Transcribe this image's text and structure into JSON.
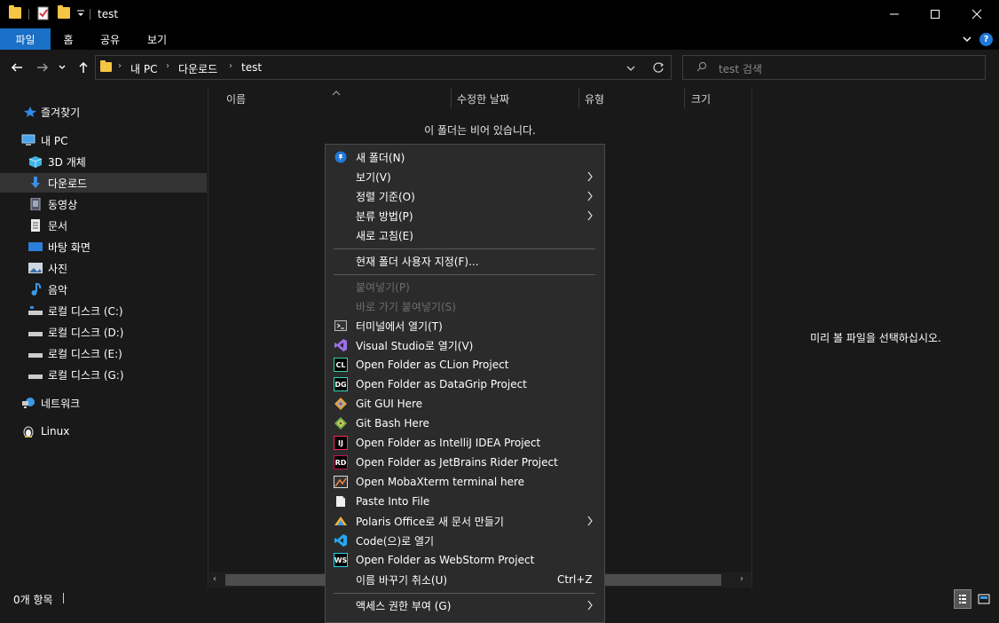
{
  "window": {
    "title": "test",
    "quick_access_icons": [
      "folder-icon",
      "properties-icon",
      "new-folder-icon",
      "customize-dropdown-icon"
    ],
    "controls": [
      "minimize-icon",
      "maximize-icon",
      "close-icon"
    ]
  },
  "ribbon": {
    "tabs": [
      {
        "label": "파일",
        "active": true
      },
      {
        "label": "홈"
      },
      {
        "label": "공유"
      },
      {
        "label": "보기"
      }
    ]
  },
  "address": {
    "segments": [
      "내 PC",
      "다운로드",
      "test"
    ],
    "search_placeholder": "test 검색"
  },
  "sidebar": {
    "items": [
      {
        "label": "즐겨찾기",
        "icon": "star-icon"
      },
      {
        "label": "내 PC",
        "icon": "pc-icon"
      },
      {
        "label": "3D 개체",
        "icon": "cube-icon"
      },
      {
        "label": "다운로드",
        "icon": "download-icon",
        "selected": true
      },
      {
        "label": "동영상",
        "icon": "video-icon"
      },
      {
        "label": "문서",
        "icon": "document-icon"
      },
      {
        "label": "바탕 화면",
        "icon": "desktop-icon"
      },
      {
        "label": "사진",
        "icon": "picture-icon"
      },
      {
        "label": "음악",
        "icon": "music-icon"
      },
      {
        "label": "로컬 디스크 (C:)",
        "icon": "drive-icon"
      },
      {
        "label": "로컬 디스크 (D:)",
        "icon": "drive-icon"
      },
      {
        "label": "로컬 디스크 (E:)",
        "icon": "drive-icon"
      },
      {
        "label": "로컬 디스크 (G:)",
        "icon": "drive-icon"
      },
      {
        "label": "네트워크",
        "icon": "network-icon"
      },
      {
        "label": "Linux",
        "icon": "linux-icon"
      }
    ]
  },
  "file_list": {
    "columns": [
      "이름",
      "수정한 날짜",
      "유형",
      "크기"
    ],
    "empty_message": "이 폴더는 비어 있습니다."
  },
  "preview": {
    "message": "미리 볼 파일을 선택하십시오."
  },
  "status": {
    "item_count": "0개 항목"
  },
  "context_menu": {
    "items": [
      {
        "label": "새 폴더(N)",
        "icon": "new-folder-pin-icon"
      },
      {
        "label": "보기(V)",
        "submenu": true
      },
      {
        "label": "정렬 기준(O)",
        "submenu": true
      },
      {
        "label": "분류 방법(P)",
        "submenu": true
      },
      {
        "label": "새로 고침(E)"
      },
      {
        "label": "현재 폴더 사용자 지정(F)..."
      },
      {
        "label": "붙여넣기(P)",
        "disabled": true
      },
      {
        "label": "바로 가기 붙여넣기(S)",
        "disabled": true
      },
      {
        "label": "터미널에서 열기(T)",
        "icon": "terminal-icon"
      },
      {
        "label": "Visual Studio로 열기(V)",
        "icon": "visual-studio-icon"
      },
      {
        "label": "Open Folder as CLion Project",
        "icon": "clion-icon",
        "badge": "CL"
      },
      {
        "label": "Open Folder as DataGrip Project",
        "icon": "datagrip-icon",
        "badge": "DG"
      },
      {
        "label": "Git GUI Here",
        "icon": "git-gui-icon"
      },
      {
        "label": "Git Bash Here",
        "icon": "git-bash-icon"
      },
      {
        "label": "Open Folder as IntelliJ IDEA Project",
        "icon": "intellij-icon",
        "badge": "IJ"
      },
      {
        "label": "Open Folder as JetBrains Rider Project",
        "icon": "rider-icon",
        "badge": "RD"
      },
      {
        "label": "Open MobaXterm terminal here",
        "icon": "mobaxterm-icon"
      },
      {
        "label": "Paste Into File",
        "icon": "paste-file-icon"
      },
      {
        "label": "Polaris Office로 새 문서 만들기",
        "icon": "polaris-icon",
        "submenu": true
      },
      {
        "label": "Code(으)로 열기",
        "icon": "vscode-icon"
      },
      {
        "label": "Open Folder as WebStorm Project",
        "icon": "webstorm-icon",
        "badge": "WS"
      },
      {
        "label": "이름 바꾸기 취소(U)",
        "shortcut": "Ctrl+Z"
      },
      {
        "label": "액세스 권한 부여 (G)",
        "submenu": true
      }
    ]
  }
}
